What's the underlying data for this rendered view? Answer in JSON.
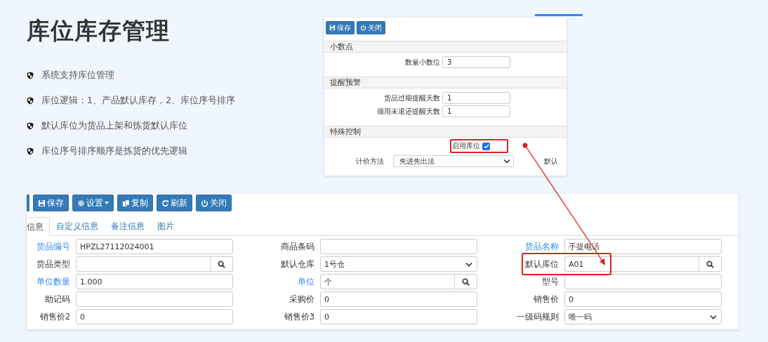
{
  "heading": "库位库存管理",
  "bullets": [
    "系统支持库位管理",
    "库位逻辑：1、产品默认库存，2、库位序号排序",
    "默认库位为货品上架和拣货默认库位",
    "库位序号排序顺序是拣货的优先逻辑"
  ],
  "settings_panel": {
    "toolbar": [
      {
        "kind": "save",
        "label": "保存"
      },
      {
        "kind": "close",
        "label": "关闭"
      }
    ],
    "sections": [
      {
        "title": "小数点",
        "rows": [
          {
            "kind": "input",
            "label": "数量小数位",
            "value": "3"
          }
        ]
      },
      {
        "title": "提醒预警",
        "rows": [
          {
            "kind": "input",
            "label": "货品过期提醒天数",
            "value": "1"
          },
          {
            "kind": "input",
            "label": "领用未退还提醒天数",
            "value": "1"
          }
        ]
      },
      {
        "title": "特殊控制",
        "rows": [
          {
            "kind": "checkbox",
            "label": "启用库位",
            "checked": true
          },
          {
            "kind": "select",
            "label": "计价方法",
            "value": "先进先出法",
            "extra_label": "默认"
          }
        ]
      }
    ]
  },
  "product_form": {
    "toolbar": [
      {
        "kind": "save",
        "label": "保存"
      },
      {
        "kind": "settings_menu",
        "label": "设置"
      },
      {
        "kind": "copy",
        "label": "复制"
      },
      {
        "kind": "refresh",
        "label": "刷新"
      },
      {
        "kind": "close",
        "label": "关闭"
      }
    ],
    "tabs": [
      {
        "label": "信息",
        "selected": true
      },
      {
        "label": "自定义信息",
        "selected": false
      },
      {
        "label": "备注信息",
        "selected": false
      },
      {
        "label": "图片",
        "selected": false
      }
    ],
    "fields": [
      {
        "label": "货品编号",
        "linked": true,
        "kind": "text",
        "value": "HPZL27112024001"
      },
      {
        "label": "商品条码",
        "linked": false,
        "kind": "text"
      },
      {
        "label": "货品名称",
        "linked": true,
        "kind": "text",
        "value": "手提电话"
      },
      {
        "label": "货品类型",
        "linked": false,
        "kind": "search"
      },
      {
        "label": "默认仓库",
        "linked": false,
        "kind": "select",
        "value": "1号仓"
      },
      {
        "label": "默认库位",
        "linked": false,
        "kind": "search",
        "value": "A01"
      },
      {
        "label": "单位数量",
        "linked": true,
        "kind": "text",
        "value": "1.000"
      },
      {
        "label": "单位",
        "linked": true,
        "kind": "search",
        "value": "个"
      },
      {
        "label": "型号",
        "linked": false,
        "kind": "text"
      },
      {
        "label": "助记码",
        "linked": false,
        "kind": "text"
      },
      {
        "label": "采购价",
        "linked": false,
        "kind": "text",
        "value": "0"
      },
      {
        "label": "销售价",
        "linked": false,
        "kind": "text",
        "value": "0"
      },
      {
        "label": "销售价2",
        "linked": false,
        "kind": "text",
        "value": "0"
      },
      {
        "label": "销售价3",
        "linked": false,
        "kind": "text",
        "value": "0"
      },
      {
        "label": "一级码规则",
        "linked": false,
        "kind": "select",
        "value": "唯一码"
      }
    ]
  }
}
